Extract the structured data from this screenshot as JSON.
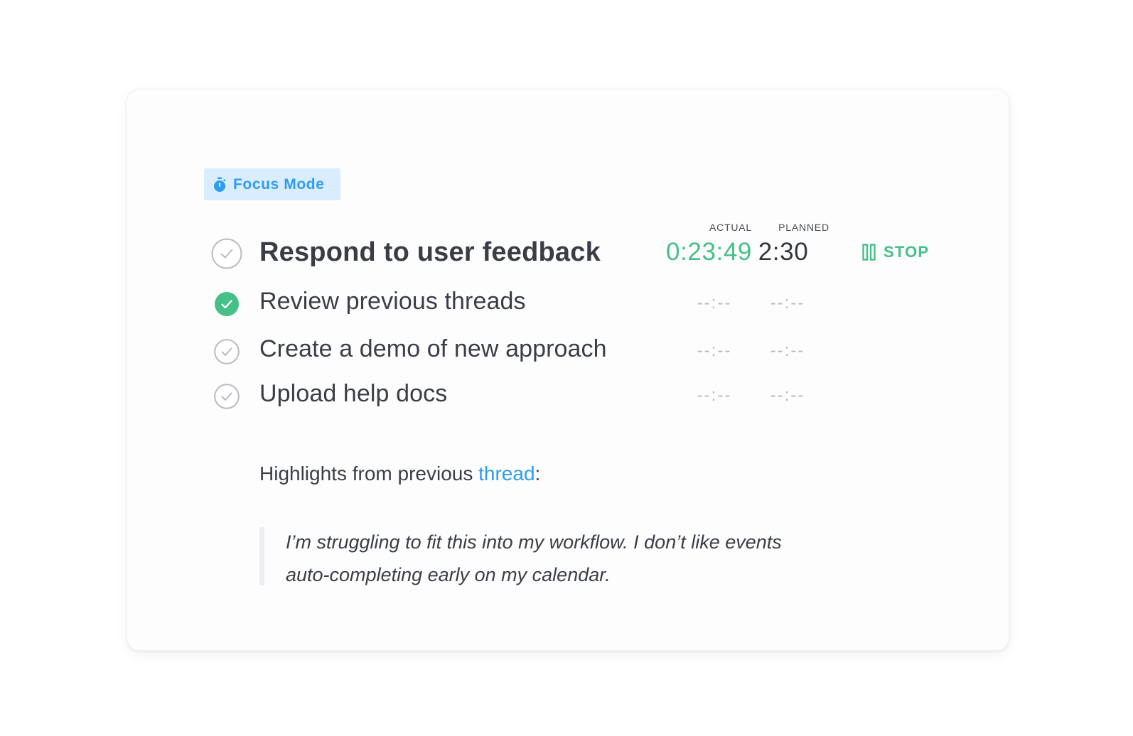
{
  "badge": {
    "icon": "stopwatch-icon",
    "label": "Focus Mode",
    "bg_color": "#d9edff",
    "text_color": "#2e9cf0"
  },
  "columns": {
    "actual": "ACTUAL",
    "planned": "PLANNED"
  },
  "current_task": {
    "title": "Respond to user feedback",
    "actual": "0:23:49",
    "planned": "2:30",
    "completed": false,
    "stop_label": "STOP",
    "stop_icon": "pause-bars-icon"
  },
  "subtasks": [
    {
      "title": "Review previous threads",
      "actual": "--:--",
      "planned": "--:--",
      "completed": true
    },
    {
      "title": "Create a demo of new approach",
      "actual": "--:--",
      "planned": "--:--",
      "completed": false
    },
    {
      "title": "Upload help docs",
      "actual": "--:--",
      "planned": "--:--",
      "completed": false
    }
  ],
  "notes": {
    "prefix": "Highlights from previous ",
    "link": "thread",
    "suffix": ":",
    "quote_line1": "I’m struggling to fit this into my workflow. I don’t like events",
    "quote_line2": "auto-completing early on my calendar."
  },
  "colors": {
    "accent_green": "#45c088",
    "accent_blue": "#2e9cf0",
    "text_dark": "#3b3e47",
    "muted": "#b6b8bf"
  }
}
